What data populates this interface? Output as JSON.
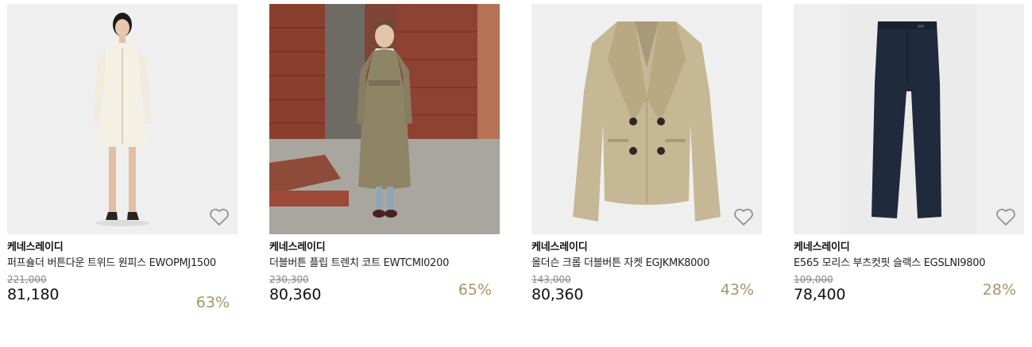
{
  "products": [
    {
      "brand": "케네스레이디",
      "name": "퍼프숄더 버튼다운 트위드 원피스 EWOPMJ1500",
      "original_price": "221,000",
      "sale_price": "81,180",
      "discount": "63%",
      "wishlist_icon": "heart-outline-icon"
    },
    {
      "brand": "케네스레이디",
      "name": "더블버튼 플립 트렌치 코트 EWTCMI0200",
      "original_price": "230,300",
      "sale_price": "80,360",
      "discount": "65%",
      "wishlist_icon": "heart-outline-icon"
    },
    {
      "brand": "케네스레이디",
      "name": "올더슨 크롭 더블버튼 자켓 EGJKMK8000",
      "original_price": "143,000",
      "sale_price": "80,360",
      "discount": "43%",
      "wishlist_icon": "heart-outline-icon"
    },
    {
      "brand": "케네스레이디",
      "name": "E565 모리스 부츠컷핏 슬랙스 EGSLNI9800",
      "original_price": "109,000",
      "sale_price": "78,400",
      "discount": "28%",
      "wishlist_icon": "heart-outline-icon"
    }
  ],
  "colors": {
    "discount": "#a89568",
    "original_price": "#888888",
    "thumb_background": "#efefef"
  }
}
